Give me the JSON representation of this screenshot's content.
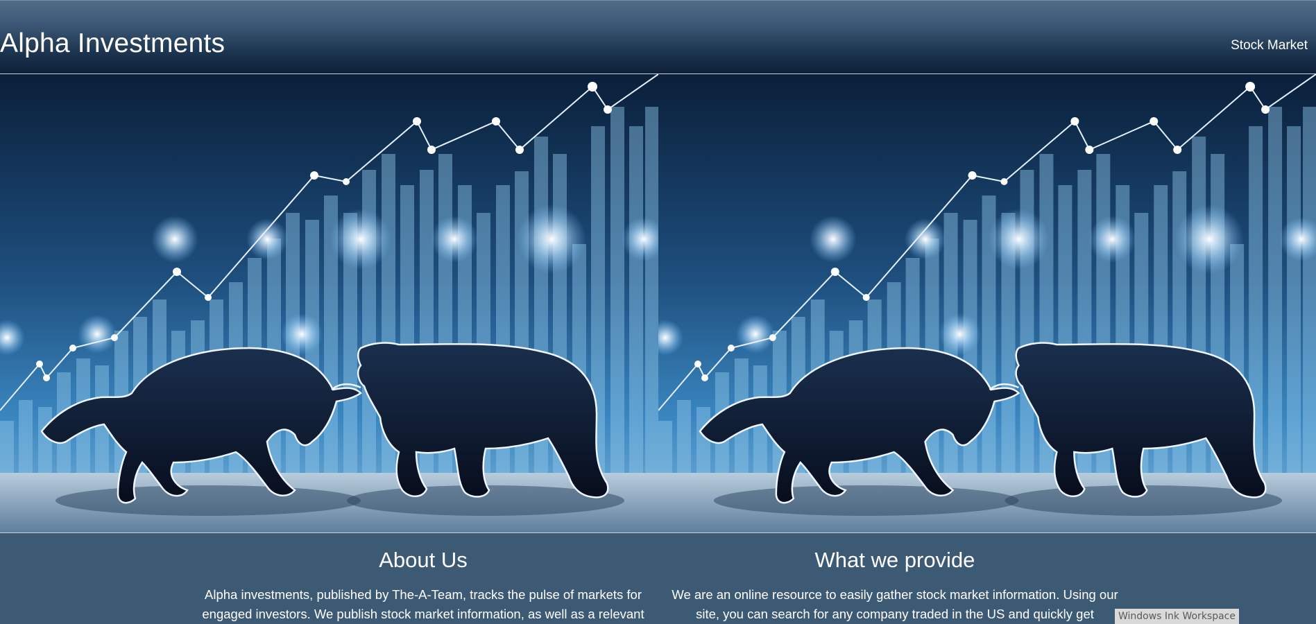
{
  "header": {
    "brand": "Alpha Investments",
    "nav": [
      {
        "label": "Stock Market"
      }
    ]
  },
  "hero": {
    "image_subject": "bull-and-bear-stock-chart",
    "panels": 2
  },
  "sections": [
    {
      "title": "About Us",
      "body": "Alpha investments, published by The-A-Team, tracks the pulse of markets for engaged investors. We publish stock market information, as well as a relevant"
    },
    {
      "title": "What we provide",
      "body": "We are an online resource to easily gather stock market information. Using our site, you can search for any company traded in the US and quickly get"
    }
  ],
  "taskbar_badge": "Windows Ink Workspace",
  "colors": {
    "page_bg": "#3d5a75",
    "header_top": "#4f6d89",
    "header_bottom": "#0f2038",
    "text": "#ffffff"
  }
}
